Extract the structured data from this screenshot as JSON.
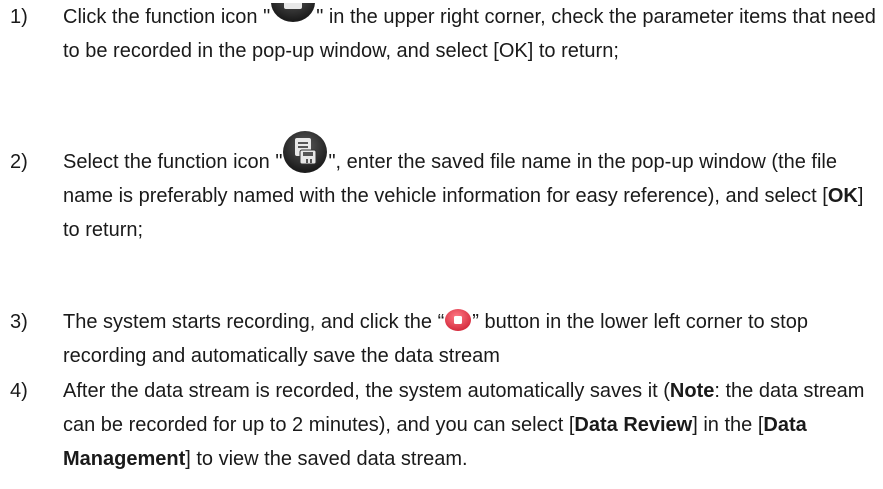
{
  "steps": [
    {
      "num": "1)",
      "before_icon": "Click the function icon \"",
      "after_icon": "\" in the upper right corner, check the parameter items that need to be recorded in the pop-up window, and select [OK] to return;",
      "icon": "parameter-select-icon"
    },
    {
      "num": "2)",
      "before_icon": "Select the function icon \"",
      "after_icon_1": "\", enter the saved file name in the pop-up window (the file name is preferably named with the vehicle information for easy reference), and select [",
      "ok": "OK",
      "after_icon_2": "] to return;",
      "icon": "save-record-icon"
    },
    {
      "num": "3)",
      "before_icon": "The system starts recording, and click the “",
      "after_icon": "” button in the lower left corner to stop recording and automatically save the data stream",
      "icon": "stop-record-icon"
    },
    {
      "num": "4)",
      "part1": "After the data stream is recorded, the system automatically saves it (",
      "note": "Note",
      "part2": ": the data stream can be recorded for up to 2 minutes), and you can select [",
      "data_review": "Data Review",
      "part3": "] in the [",
      "data_management": "Data Management",
      "part4": "] to view the saved data stream."
    }
  ],
  "colors": {
    "text": "#1a1a1a",
    "icon_dark": "#2b2b2b",
    "record_red": "#e5374a"
  }
}
